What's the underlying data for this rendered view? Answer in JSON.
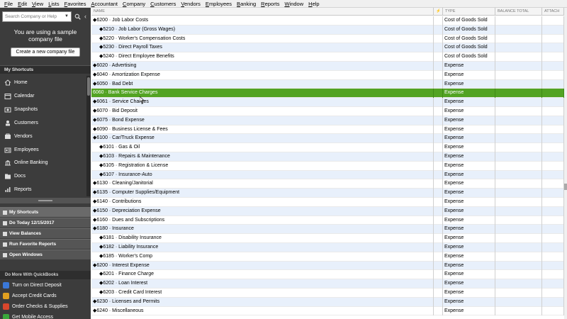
{
  "menu": [
    "File",
    "Edit",
    "View",
    "Lists",
    "Favorites",
    "Accountant",
    "Company",
    "Customers",
    "Vendors",
    "Employees",
    "Banking",
    "Reports",
    "Window",
    "Help"
  ],
  "sidebar": {
    "search_placeholder": "Search Company or Help",
    "sample_message_line1": "You are using a sample",
    "sample_message_line2": "company file",
    "create_button": "Create a new company file",
    "my_shortcuts_header": "My Shortcuts",
    "shortcuts": [
      {
        "label": "Home",
        "icon": "home-icon"
      },
      {
        "label": "Calendar",
        "icon": "calendar-icon"
      },
      {
        "label": "Snapshots",
        "icon": "snapshots-icon"
      },
      {
        "label": "Customers",
        "icon": "customers-icon"
      },
      {
        "label": "Vendors",
        "icon": "vendors-icon"
      },
      {
        "label": "Employees",
        "icon": "employees-icon"
      },
      {
        "label": "Online Banking",
        "icon": "online-banking-icon"
      },
      {
        "label": "Docs",
        "icon": "docs-icon"
      },
      {
        "label": "Reports",
        "icon": "reports-icon"
      }
    ],
    "bars": [
      "My Shortcuts",
      "Do Today 12/15/2017",
      "View Balances",
      "Run Favorite Reports",
      "Open Windows"
    ],
    "do_more_header": "Do More With QuickBooks",
    "do_more": [
      {
        "label": "Turn on Direct Deposit",
        "color": "#3a78d8"
      },
      {
        "label": "Accept Credit Cards",
        "color": "#e0a020"
      },
      {
        "label": "Order Checks & Supplies",
        "color": "#d8462c"
      },
      {
        "label": "Get Mobile Access",
        "color": "#3aa83a"
      }
    ]
  },
  "table": {
    "columns": {
      "name": "NAME",
      "flag": "⚡",
      "type": "TYPE",
      "balance": "BALANCE TOTAL",
      "attach": "ATTACH"
    },
    "selected_color": "#52a323",
    "rows": [
      {
        "name": "◆6200 · Job Labor Costs",
        "type": "Cost of Goods Sold",
        "indent": 0
      },
      {
        "name": "◆5210 · Job Labor (Gross Wages)",
        "type": "Cost of Goods Sold",
        "indent": 1
      },
      {
        "name": "◆5220 · Worker's Compensation Costs",
        "type": "Cost of Goods Sold",
        "indent": 1
      },
      {
        "name": "◆5230 · Direct Payroll Taxes",
        "type": "Cost of Goods Sold",
        "indent": 1
      },
      {
        "name": "◆5240 · Direct Employee Benefits",
        "type": "Cost of Goods Sold",
        "indent": 1
      },
      {
        "name": "◆6020 · Advertising",
        "type": "Expense",
        "indent": 0
      },
      {
        "name": "◆6040 · Amortization Expense",
        "type": "Expense",
        "indent": 0
      },
      {
        "name": "◆6050 · Bad Debt",
        "type": "Expense",
        "indent": 0
      },
      {
        "name": "6060 · Bank Service Charges",
        "type": "Expense",
        "indent": 0,
        "selected": true
      },
      {
        "name": "◆6061 · Service Charges",
        "type": "Expense",
        "indent": 0
      },
      {
        "name": "◆6070 · Bid Deposit",
        "type": "Expense",
        "indent": 0
      },
      {
        "name": "◆6075 · Bond Expense",
        "type": "Expense",
        "indent": 0
      },
      {
        "name": "◆6090 · Business License & Fees",
        "type": "Expense",
        "indent": 0
      },
      {
        "name": "◆6100 · Car/Truck Expense",
        "type": "Expense",
        "indent": 0
      },
      {
        "name": "◆6101 · Gas & Oil",
        "type": "Expense",
        "indent": 1
      },
      {
        "name": "◆6103 · Repairs & Maintenance",
        "type": "Expense",
        "indent": 1
      },
      {
        "name": "◆6105 · Registration & License",
        "type": "Expense",
        "indent": 1
      },
      {
        "name": "◆6107 · Insurance-Auto",
        "type": "Expense",
        "indent": 1
      },
      {
        "name": "◆6130 · Cleaning/Janitorial",
        "type": "Expense",
        "indent": 0
      },
      {
        "name": "◆6135 · Computer Supplies/Equipment",
        "type": "Expense",
        "indent": 0
      },
      {
        "name": "◆6140 · Contributions",
        "type": "Expense",
        "indent": 0
      },
      {
        "name": "◆6150 · Depreciation Expense",
        "type": "Expense",
        "indent": 0
      },
      {
        "name": "◆6160 · Dues and Subscriptions",
        "type": "Expense",
        "indent": 0
      },
      {
        "name": "◆6180 · Insurance",
        "type": "Expense",
        "indent": 0
      },
      {
        "name": "◆6181 · Disability Insurance",
        "type": "Expense",
        "indent": 1
      },
      {
        "name": "◆6182 · Liability Insurance",
        "type": "Expense",
        "indent": 1
      },
      {
        "name": "◆6185 · Worker's Comp",
        "type": "Expense",
        "indent": 1
      },
      {
        "name": "◆6200 · Interest Expense",
        "type": "Expense",
        "indent": 0
      },
      {
        "name": "◆6201 · Finance Charge",
        "type": "Expense",
        "indent": 1
      },
      {
        "name": "◆6202 · Loan Interest",
        "type": "Expense",
        "indent": 1
      },
      {
        "name": "◆6203 · Credit Card Interest",
        "type": "Expense",
        "indent": 1
      },
      {
        "name": "◆6230 · Licenses and Permits",
        "type": "Expense",
        "indent": 0
      },
      {
        "name": "◆6240 · Miscellaneous",
        "type": "Expense",
        "indent": 0
      }
    ]
  }
}
